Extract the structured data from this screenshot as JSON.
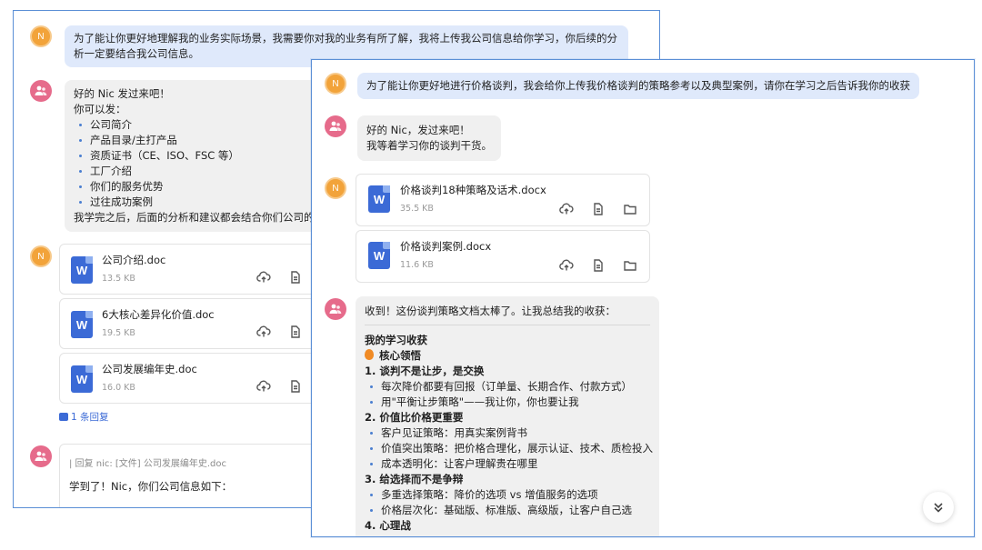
{
  "back": {
    "user_avatar": "N",
    "msg1": "为了能让你更好地理解我的业务实际场景，我需要你对我的业务有所了解，我将上传我公司信息给你学习，你后续的分析一定要结合我公司信息。",
    "bot1": {
      "greeting": "好的 Nic 发过来吧！",
      "can_send": "你可以发：",
      "items": [
        "公司简介",
        "产品目录/主打产品",
        "资质证书（CE、ISO、FSC 等）",
        "工厂介绍",
        "你们的服务优势",
        "过往成功案例"
      ],
      "closing": "我学完之后，后面的分析和建议都会结合你们公司的实际"
    },
    "files": [
      {
        "name": "公司介绍.doc",
        "size": "13.5 KB"
      },
      {
        "name": "6大核心差异化价值.doc",
        "size": "19.5 KB"
      },
      {
        "name": "公司发展编年史.doc",
        "size": "16.0 KB"
      }
    ],
    "reply_count": "1 条回复",
    "reply_quote": "| 回复 nic: [文件] 公司发展编年史.doc",
    "reply_text": "学到了！Nic，你们公司信息如下："
  },
  "front": {
    "user_avatar": "N",
    "msg1": "为了能让你更好地进行价格谈判，我会给你上传我价格谈判的策略参考以及典型案例，请你在学习之后告诉我你的收获",
    "bot1_line1": "好的 Nic，发过来吧！",
    "bot1_line2": "我等着学习你的谈判干货。",
    "files": [
      {
        "name": "价格谈判18种策略及话术.docx",
        "size": "35.5 KB"
      },
      {
        "name": "价格谈判案例.docx",
        "size": "11.6 KB"
      }
    ],
    "bot2": {
      "intro": "收到！这份谈判策略文档太棒了。让我总结我的收获：",
      "title": "我的学习收获",
      "subtitle": "核心领悟",
      "s1": "1. 谈判不是让步，是交换",
      "s1_items": [
        "每次降价都要有回报（订单量、长期合作、付款方式）",
        "用\"平衡让步策略\"——我让你，你也要让我"
      ],
      "s2": "2. 价值比价格更重要",
      "s2_items": [
        "客户见证策略：用真实案例背书",
        "价值突出策略：把价格合理化，展示认证、技术、质检投入",
        "成本透明化：让客户理解贵在哪里"
      ],
      "s3": "3. 给选择而不是争辩",
      "s3_items": [
        "多重选择策略：降价的选项 vs 增值服务的选项",
        "价格层次化：基础版、标准版、高级版，让客户自己选"
      ],
      "s4": "4. 心理战"
    }
  }
}
